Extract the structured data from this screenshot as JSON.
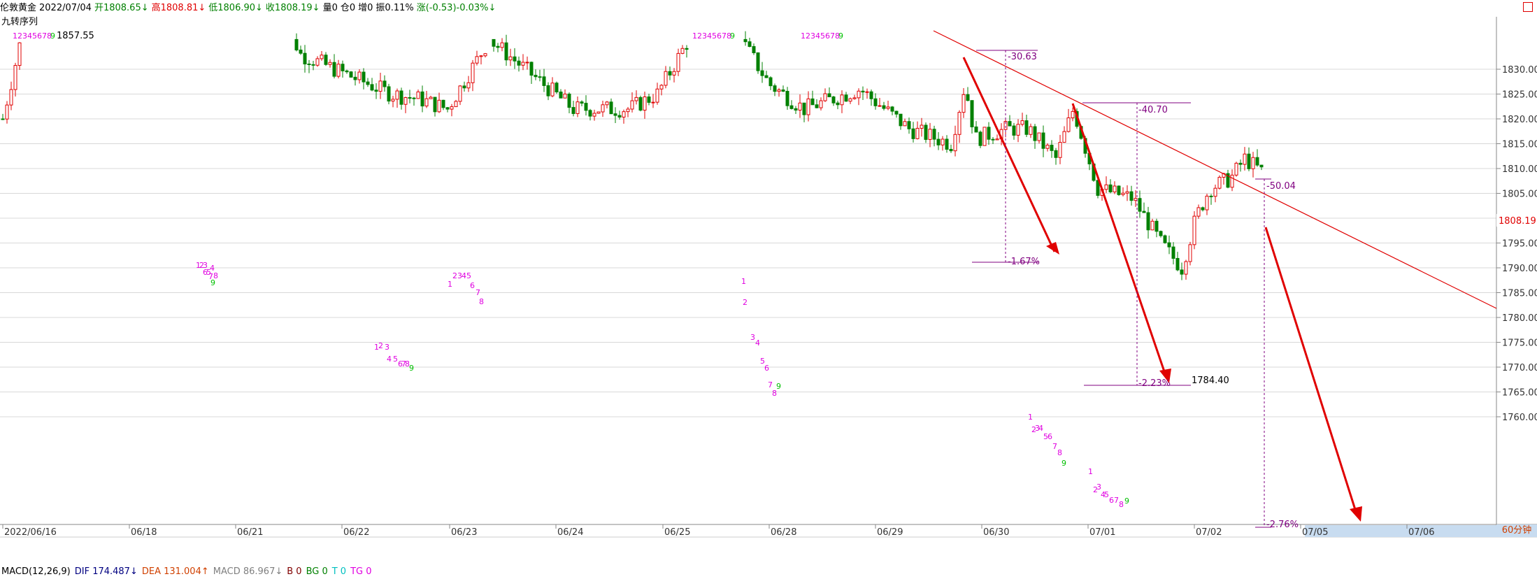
{
  "header": {
    "symbol": "伦敦黄金",
    "date": "2022/07/04",
    "open": "开1808.65↓",
    "high": "高1808.81↓",
    "low": "低1806.90↓",
    "close": "收1808.19↓",
    "volume": "量0",
    "position": "仓0",
    "increase": "增0",
    "amplitude": "振0.11%",
    "change": "涨(-0.53)-0.03%↓"
  },
  "indicator_name": "九转序列",
  "high_marker": "1857.55",
  "current_price": "1808.19",
  "period": "60分钟",
  "macd": {
    "name": "MACD(12,26,9)",
    "dif": "DIF 174.487↓",
    "dea": "DEA 131.004↑",
    "macd": "MACD 86.967↓",
    "b": "B 0",
    "bg": "BG 0",
    "t": "T 0",
    "tg": "TG 0"
  },
  "colors": {
    "up": "#e00000",
    "down": "#008000",
    "trend": "#e00000",
    "annotation": "#800080",
    "seq_magenta": "#e000e0",
    "seq_green": "#00c000"
  },
  "chart_data": {
    "type": "candlestick",
    "ylim": [
      1760,
      1836
    ],
    "yticks": [
      1830,
      1825,
      1820,
      1815,
      1810,
      1805,
      1800,
      1795,
      1790,
      1785,
      1780,
      1775,
      1770,
      1765,
      1760
    ],
    "ytick_labels": [
      "1830.00",
      "1825.00",
      "1820.00",
      "1815.00",
      "1810.00",
      "1805.00",
      "1800.00",
      "1795.00",
      "1790.00",
      "1785.00",
      "1780.00",
      "1775.00",
      "1770.00",
      "1765.00",
      "1760.00"
    ],
    "xtick_labels": [
      "2022/06/16",
      "06/18",
      "06/21",
      "06/22",
      "06/23",
      "06/24",
      "06/25",
      "06/28",
      "06/29",
      "06/30",
      "07/01",
      "07/02",
      "07/05",
      "07/06"
    ],
    "annotations": [
      {
        "text": "-30.63",
        "x_index": 1.0,
        "y": 1831.5
      },
      {
        "text": "-1.67%",
        "x_index": 1.0,
        "y": 1802.3
      },
      {
        "text": "-40.70",
        "x_index": 2.0,
        "y": 1825.0
      },
      {
        "text": "-2.23%",
        "x_index": 2.0,
        "y": 1784.6
      },
      {
        "text": "1784.40",
        "x_index": 3.0,
        "y": 1785.0
      },
      {
        "text": "-50.04",
        "x_index": 4.0,
        "y": 1814.0
      },
      {
        "text": "-2.76%",
        "x_index": 4.0,
        "y": 1764.0
      }
    ]
  }
}
